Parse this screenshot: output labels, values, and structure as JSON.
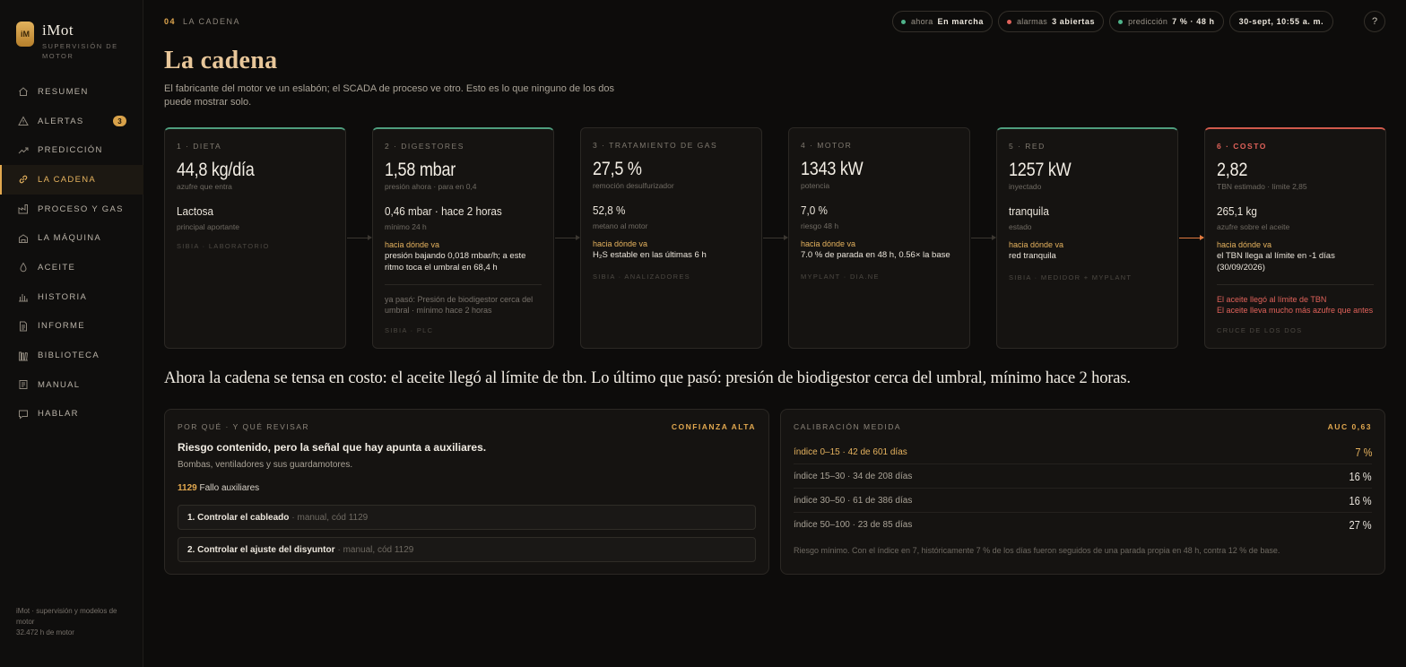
{
  "app": {
    "title": "iMot",
    "subtitle": "SUPERVISIÓN DE MOTOR",
    "logo": "iM"
  },
  "nav": [
    {
      "label": "RESUMEN",
      "icon": "home-icon"
    },
    {
      "label": "ALERTAS",
      "icon": "alert-icon",
      "badge": "3"
    },
    {
      "label": "PREDICCIÓN",
      "icon": "trend-icon"
    },
    {
      "label": "LA CADENA",
      "icon": "link-icon",
      "active": true
    },
    {
      "label": "PROCESO Y GAS",
      "icon": "factory-icon"
    },
    {
      "label": "LA MÁQUINA",
      "icon": "engine-icon"
    },
    {
      "label": "ACEITE",
      "icon": "drop-icon"
    },
    {
      "label": "HISTORIA",
      "icon": "bars-icon"
    },
    {
      "label": "INFORME",
      "icon": "doc-icon"
    },
    {
      "label": "BIBLIOTECA",
      "icon": "books-icon"
    },
    {
      "label": "MANUAL",
      "icon": "manual-icon"
    },
    {
      "label": "HABLAR",
      "icon": "chat-icon"
    }
  ],
  "footer": {
    "line1": "iMot · supervisión y modelos de motor",
    "line2": "32.472 h de motor"
  },
  "breadcrumb": {
    "num": "04",
    "label": "LA CADENA"
  },
  "status": {
    "now_label": "ahora",
    "now_value": "En marcha",
    "now_color": "#4fb38a",
    "alarms_label": "alarmas",
    "alarms_value": "3 abiertas",
    "alarms_color": "#e0625a",
    "pred_label": "predicción",
    "pred_value": "7 % · 48 h",
    "pred_color": "#4fb38a",
    "date": "30-sept, 10:55 a. m.",
    "help": "?"
  },
  "page": {
    "title": "La cadena",
    "description": "El fabricante del motor ve un eslabón; el SCADA de proceso ve otro. Esto es lo que ninguno de los dos puede mostrar solo."
  },
  "stages": [
    {
      "label": "1 · DIETA",
      "value": "44,8 kg/día",
      "sub": "azufre que entra",
      "secondary": "Lactosa",
      "secondary_sub": "principal aportante",
      "source": "SIBIA · LABORATORIO"
    },
    {
      "label": "2 · DIGESTORES",
      "value": "1,58 mbar",
      "sub": "presión ahora · para en 0,4",
      "secondary": "0,46 mbar · hace 2 horas",
      "secondary_sub": "mínimo 24 h",
      "hint_label": "hacia dónde va",
      "hint": "presión bajando 0,018 mbar/h; a este ritmo toca el umbral en 68,4 h",
      "past": "ya pasó: Presión de biodigestor cerca del umbral · mínimo hace 2 horas",
      "source": "SIBIA · PLC"
    },
    {
      "label": "3 · TRATAMIENTO DE GAS",
      "value": "27,5 %",
      "sub": "remoción desulfurizador",
      "secondary": "52,8 %",
      "secondary_sub": "metano al motor",
      "hint_label": "hacia dónde va",
      "hint": "H₂S estable en las últimas 6 h",
      "source": "SIBIA · ANALIZADORES"
    },
    {
      "label": "4 · MOTOR",
      "value": "1343 kW",
      "sub": "potencia",
      "secondary": "7,0 %",
      "secondary_sub": "riesgo 48 h",
      "hint_label": "hacia dónde va",
      "hint": "7.0 % de parada en 48 h, 0.56× la base",
      "source": "MYPLANT · DIA.NE"
    },
    {
      "label": "5 · RED",
      "value": "1257 kW",
      "sub": "inyectado",
      "secondary": "tranquila",
      "secondary_sub": "estado",
      "hint_label": "hacia dónde va",
      "hint": "red tranquila",
      "source": "SIBIA · MEDIDOR + MYPLANT"
    },
    {
      "label": "6 · COSTO",
      "value": "2,82",
      "sub": "TBN estimado · límite 2,85",
      "secondary": "265,1 kg",
      "secondary_sub": "azufre sobre el aceite",
      "hint_label": "hacia dónde va",
      "hint": "el TBN llega al límite en -1 días (30/09/2026)",
      "alert1": "El aceite llegó al límite de TBN",
      "alert2": "El aceite lleva mucho más azufre que antes",
      "source": "CRUCE DE LOS DOS"
    }
  ],
  "headline": "Ahora la cadena se tensa en costo: el aceite llegó al límite de tbn. Lo último que pasó: presión de biodigestor cerca del umbral, mínimo hace 2 horas.",
  "why": {
    "header": "POR QUÉ · Y QUÉ REVISAR",
    "confidence": "CONFIANZA ALTA",
    "title": "Riesgo contenido, pero la señal que hay apunta a auxiliares.",
    "subtitle": "Bombas, ventiladores y sus guardamotores.",
    "code": "1129",
    "code_label": "Fallo auxiliares",
    "checks": [
      {
        "title": "1. Controlar el cableado",
        "meta": "· manual, cód 1129"
      },
      {
        "title": "2. Controlar el ajuste del disyuntor",
        "meta": "· manual, cód 1129"
      }
    ]
  },
  "calibration": {
    "header": "CALIBRACIÓN MEDIDA",
    "auc": "AUC 0,63",
    "rows": [
      {
        "label": "índice 0–15 · 42 de 601 días",
        "pct": "7 %"
      },
      {
        "label": "índice 15–30 · 34 de 208 días",
        "pct": "16 %"
      },
      {
        "label": "índice 30–50 · 61 de 386 días",
        "pct": "16 %"
      },
      {
        "label": "índice 50–100 · 23 de 85 días",
        "pct": "27 %"
      }
    ],
    "note": "Riesgo mínimo. Con el índice en 7, históricamente 7 % de los días fueron seguidos de una parada propia en 48 h, contra 12 % de base."
  }
}
